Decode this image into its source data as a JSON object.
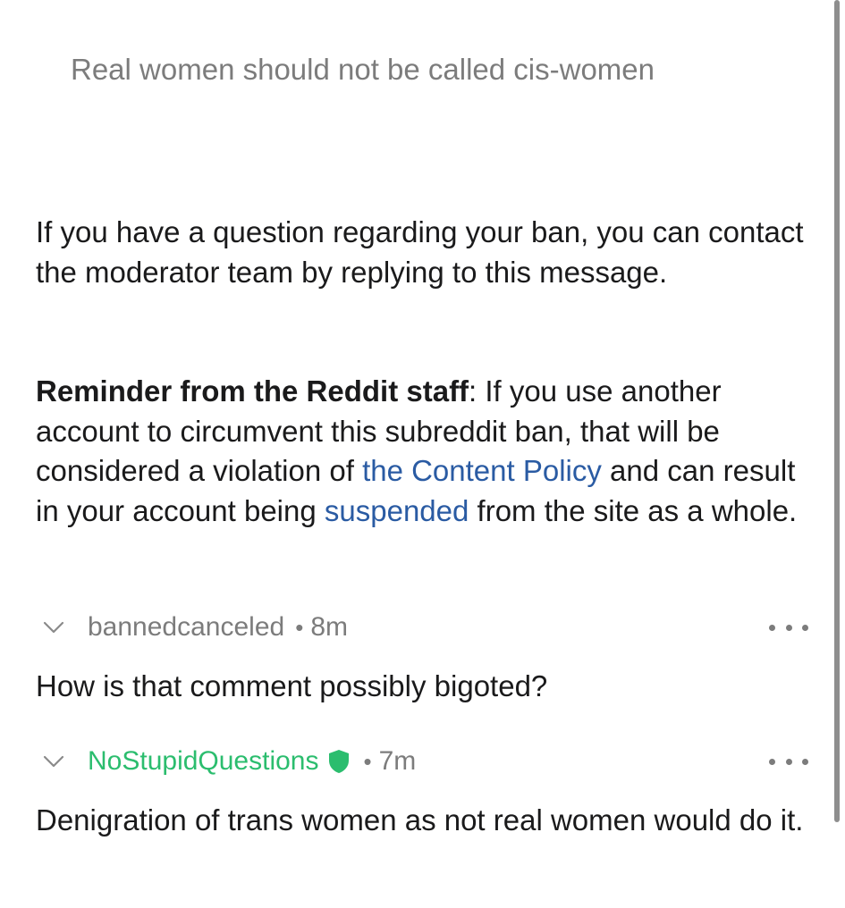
{
  "quoted_comment": "Real women should not be called cis-women",
  "ban_message": {
    "contact_text": "If you have a question regarding your ban, you can contact the moderator team by replying to this message.",
    "reminder_bold": "Reminder from the Reddit staff",
    "reminder_colon": ": If you use another account to circumvent this subreddit ban, that will be considered a violation of ",
    "content_policy_link": "the Content Policy",
    "reminder_middle": " and can result in your account being ",
    "suspended_link": "suspended",
    "reminder_end": " from the site as a whole."
  },
  "comments": [
    {
      "author": "bannedcanceled",
      "separator": "•",
      "time": "8m",
      "body": "How is that comment possibly bigoted?"
    },
    {
      "author": "NoStupidQuestions",
      "separator": "•",
      "time": "7m",
      "body": "Denigration of trans women as not real women would do it.",
      "is_moderator": true,
      "badge_icon": "moderator-shield-icon"
    }
  ],
  "colors": {
    "link": "#2a5ba3",
    "moderator": "#2bbd6e",
    "muted": "#7c7c7c",
    "text": "#1a1a1b"
  }
}
